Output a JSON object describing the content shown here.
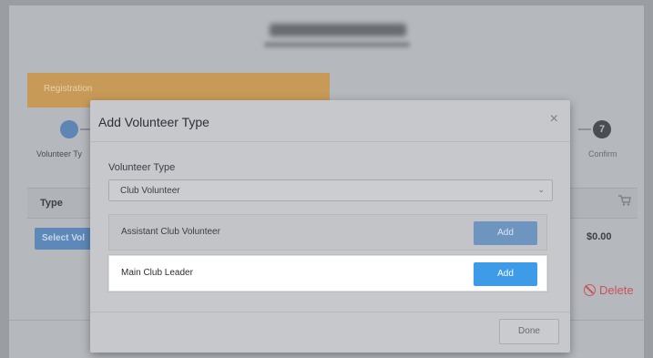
{
  "background": {
    "registration_label": "Registration",
    "step_first_label": "Volunteer Ty",
    "step_last_number": "7",
    "step_last_label": "Confirm",
    "table_type_header": "Type",
    "select_button_label": "Select Vol",
    "amount": "$0.00",
    "delete_label": "Delete"
  },
  "modal": {
    "title": "Add Volunteer Type",
    "close_glyph": "×",
    "field_label": "Volunteer Type",
    "select_value": "Club Volunteer",
    "options": [
      {
        "name": "Assistant Club Volunteer",
        "button": "Add"
      },
      {
        "name": "Main Club Leader",
        "button": "Add"
      }
    ],
    "done_label": "Done"
  },
  "colors": {
    "accent": "#3d9be8",
    "registration": "#c79a57",
    "danger": "#c6555b"
  },
  "icons": [
    "check-icon",
    "cart-icon",
    "delete-circle-icon",
    "chevron-down-icon",
    "close-icon"
  ]
}
